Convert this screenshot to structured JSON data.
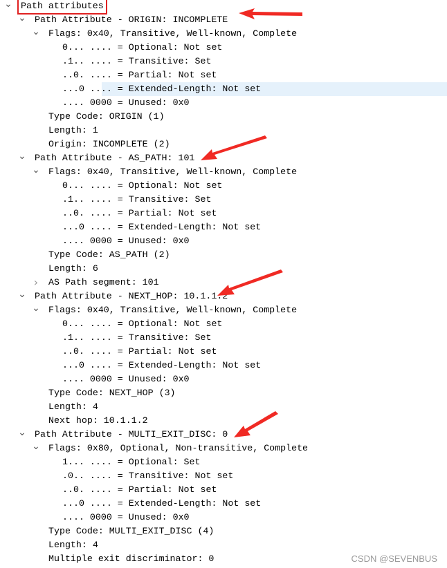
{
  "tree": {
    "rows": [
      {
        "level": 0,
        "expander": "expanded",
        "text": "Path attributes",
        "boxed": true
      },
      {
        "level": 1,
        "expander": "expanded",
        "text": "Path Attribute - ORIGIN: INCOMPLETE"
      },
      {
        "level": 2,
        "expander": "expanded",
        "text": "Flags: 0x40, Transitive, Well-known, Complete"
      },
      {
        "level": 3,
        "expander": "none",
        "text": "0... .... = Optional: Not set"
      },
      {
        "level": 3,
        "expander": "none",
        "text": ".1.. .... = Transitive: Set"
      },
      {
        "level": 3,
        "expander": "none",
        "text": "..0. .... = Partial: Not set"
      },
      {
        "level": 3,
        "expander": "none",
        "text": "...0 .... = Extended-Length: Not set",
        "selected": true
      },
      {
        "level": 3,
        "expander": "none",
        "text": ".... 0000 = Unused: 0x0"
      },
      {
        "level": 2,
        "expander": "none",
        "text": "Type Code: ORIGIN (1)"
      },
      {
        "level": 2,
        "expander": "none",
        "text": "Length: 1"
      },
      {
        "level": 2,
        "expander": "none",
        "text": "Origin: INCOMPLETE (2)"
      },
      {
        "level": 1,
        "expander": "expanded",
        "text": "Path Attribute - AS_PATH: 101"
      },
      {
        "level": 2,
        "expander": "expanded",
        "text": "Flags: 0x40, Transitive, Well-known, Complete"
      },
      {
        "level": 3,
        "expander": "none",
        "text": "0... .... = Optional: Not set"
      },
      {
        "level": 3,
        "expander": "none",
        "text": ".1.. .... = Transitive: Set"
      },
      {
        "level": 3,
        "expander": "none",
        "text": "..0. .... = Partial: Not set"
      },
      {
        "level": 3,
        "expander": "none",
        "text": "...0 .... = Extended-Length: Not set"
      },
      {
        "level": 3,
        "expander": "none",
        "text": ".... 0000 = Unused: 0x0"
      },
      {
        "level": 2,
        "expander": "none",
        "text": "Type Code: AS_PATH (2)"
      },
      {
        "level": 2,
        "expander": "none",
        "text": "Length: 6"
      },
      {
        "level": 2,
        "expander": "collapsed",
        "text": "AS Path segment: 101"
      },
      {
        "level": 1,
        "expander": "expanded",
        "text": "Path Attribute - NEXT_HOP: 10.1.1.2"
      },
      {
        "level": 2,
        "expander": "expanded",
        "text": "Flags: 0x40, Transitive, Well-known, Complete"
      },
      {
        "level": 3,
        "expander": "none",
        "text": "0... .... = Optional: Not set"
      },
      {
        "level": 3,
        "expander": "none",
        "text": ".1.. .... = Transitive: Set"
      },
      {
        "level": 3,
        "expander": "none",
        "text": "..0. .... = Partial: Not set"
      },
      {
        "level": 3,
        "expander": "none",
        "text": "...0 .... = Extended-Length: Not set"
      },
      {
        "level": 3,
        "expander": "none",
        "text": ".... 0000 = Unused: 0x0"
      },
      {
        "level": 2,
        "expander": "none",
        "text": "Type Code: NEXT_HOP (3)"
      },
      {
        "level": 2,
        "expander": "none",
        "text": "Length: 4"
      },
      {
        "level": 2,
        "expander": "none",
        "text": "Next hop: 10.1.1.2"
      },
      {
        "level": 1,
        "expander": "expanded",
        "text": "Path Attribute - MULTI_EXIT_DISC: 0"
      },
      {
        "level": 2,
        "expander": "expanded",
        "text": "Flags: 0x80, Optional, Non-transitive, Complete"
      },
      {
        "level": 3,
        "expander": "none",
        "text": "1... .... = Optional: Set"
      },
      {
        "level": 3,
        "expander": "none",
        "text": ".0.. .... = Transitive: Not set"
      },
      {
        "level": 3,
        "expander": "none",
        "text": "..0. .... = Partial: Not set"
      },
      {
        "level": 3,
        "expander": "none",
        "text": "...0 .... = Extended-Length: Not set"
      },
      {
        "level": 3,
        "expander": "none",
        "text": ".... 0000 = Unused: 0x0"
      },
      {
        "level": 2,
        "expander": "none",
        "text": "Type Code: MULTI_EXIT_DISC (4)"
      },
      {
        "level": 2,
        "expander": "none",
        "text": "Length: 4"
      },
      {
        "level": 2,
        "expander": "none",
        "text": "Multiple exit discriminator: 0"
      }
    ]
  },
  "annotations": {
    "arrow_color": "#f02a24",
    "box_color": "#e02020"
  },
  "colors": {
    "selection": "#e5f1fb"
  },
  "watermark": "CSDN @SEVENBUS"
}
